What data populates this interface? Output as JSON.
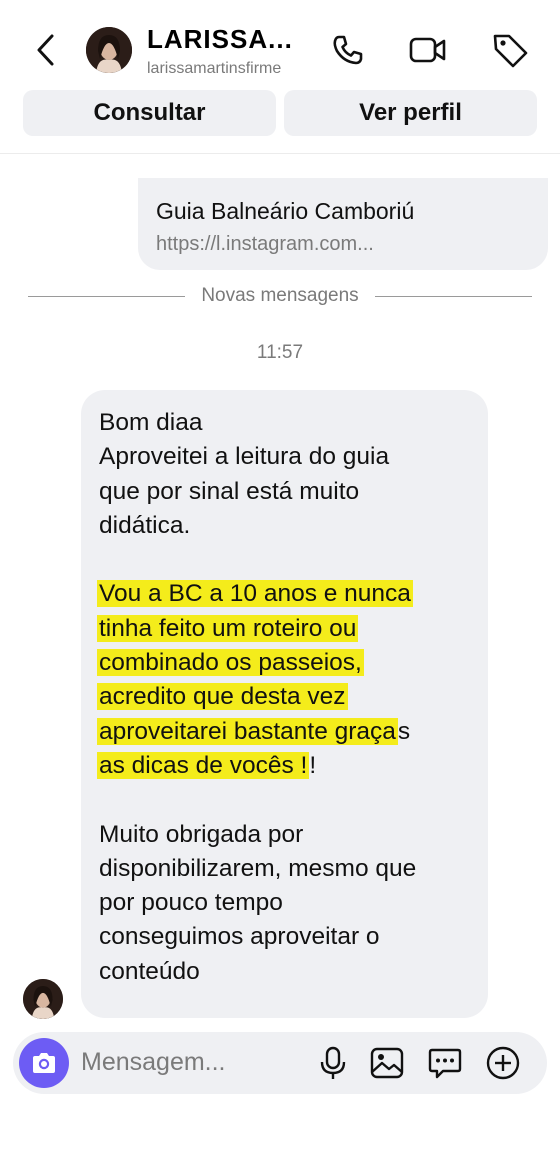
{
  "header": {
    "name": "LARISSA...",
    "username": "larissamartinsfirme"
  },
  "actions": {
    "consultar": "Consultar",
    "ver_perfil": "Ver perfil"
  },
  "link_card": {
    "title": "Guia Balneário Camboriú",
    "url": "https://l.instagram.com..."
  },
  "divider": "Novas mensagens",
  "timestamp": "11:57",
  "message": {
    "lines": [
      "Bom diaa",
      "Aproveitei a leitura do guia",
      "que por sinal está muito",
      "didática.",
      "Vou a BC a 10 anos e nunca",
      "tinha feito um roteiro ou",
      "combinado os passeios,",
      "acredito que desta vez",
      "aproveitarei bastante graça",
      "s",
      "as dicas de vocês !",
      "!",
      "Muito obrigada por",
      "disponibilizarem, mesmo que",
      "por pouco tempo",
      "conseguimos aproveitar o",
      "conteúdo"
    ],
    "highlight_color": "#f4ec1b"
  },
  "composer": {
    "placeholder": "Mensagem..."
  },
  "colors": {
    "bubble_bg": "#eff0f3",
    "camera_button": "#6d5cf4",
    "secondary_text": "#7a7a7a"
  },
  "icons": [
    "back-arrow-icon",
    "phone-icon",
    "video-camera-icon",
    "tag-icon",
    "camera-icon",
    "microphone-icon",
    "gallery-icon",
    "sticker-icon",
    "plus-icon"
  ]
}
